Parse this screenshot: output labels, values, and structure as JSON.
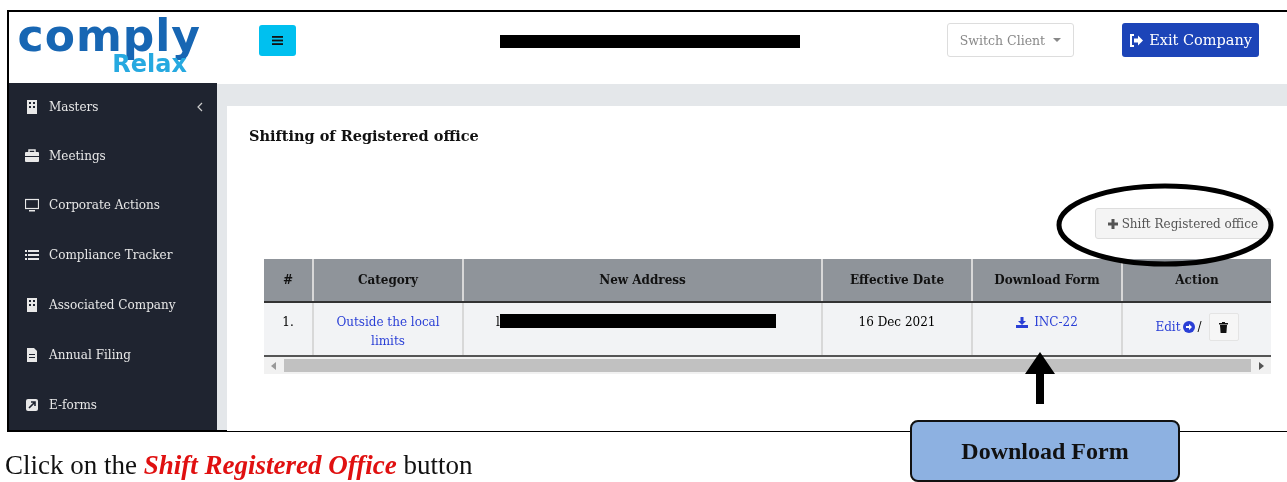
{
  "logo": {
    "line_1": "comply",
    "line_2": "Relax"
  },
  "header": {
    "switch_client": "Switch Client",
    "exit_button": "Exit Company"
  },
  "sidebar": {
    "items": [
      {
        "label": "Masters",
        "has_submenu": true
      },
      {
        "label": "Meetings",
        "has_submenu": false
      },
      {
        "label": "Corporate Actions",
        "has_submenu": false
      },
      {
        "label": "Compliance Tracker",
        "has_submenu": false
      },
      {
        "label": "Associated Company",
        "has_submenu": false
      },
      {
        "label": "Annual Filing",
        "has_submenu": false
      },
      {
        "label": "E-forms",
        "has_submenu": false
      }
    ]
  },
  "page_title": "Shifting of Registered office",
  "add_button": "Shift Registered office",
  "table": {
    "columns": [
      "#",
      "Category",
      "New Address",
      "Effective Date",
      "Download Form",
      "Action"
    ],
    "rows": [
      {
        "number": "1.",
        "category": "Outside the local limits",
        "new_address": "l",
        "effective_date": "16 Dec 2021",
        "download_form": "INC-22",
        "edit": "Edit",
        "separator": "/"
      }
    ]
  },
  "callout": "Download Form",
  "instruction": "Click on the *Shift Registered Office* button"
}
